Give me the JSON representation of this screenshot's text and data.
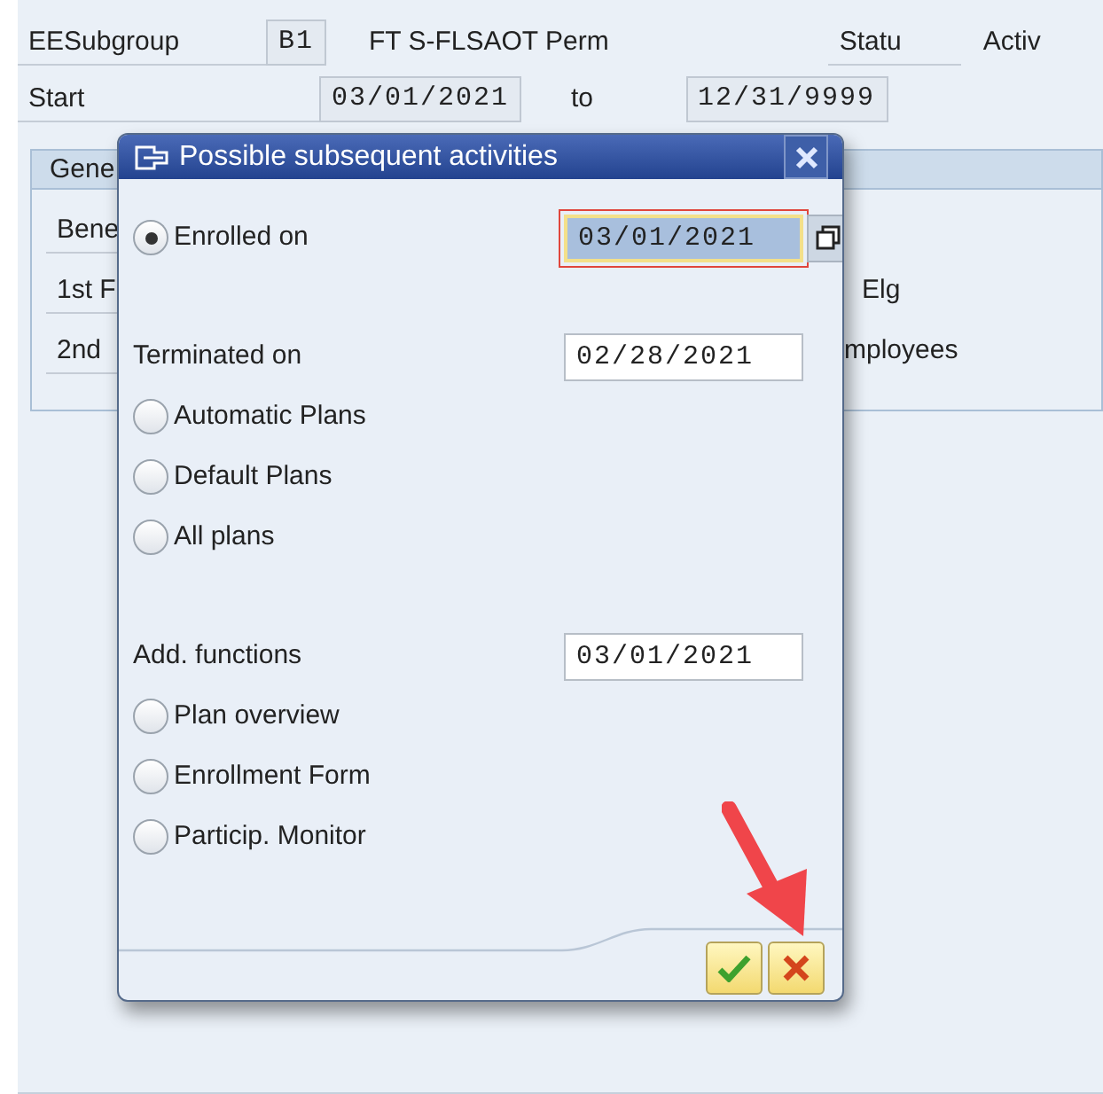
{
  "header": {
    "subgroup_label": "EESubgroup",
    "subgroup_code": "B1",
    "subgroup_text": "FT S-FLSAOT Perm",
    "status_label": "Statu",
    "status_value": "Activ",
    "start_label": "Start",
    "start_date": "03/01/2021",
    "to_label": "to",
    "end_date": "12/31/9999"
  },
  "group_box": {
    "tab": "Gene",
    "rows": [
      {
        "label": "Bene"
      },
      {
        "label": "1st F",
        "value": "Elg"
      },
      {
        "label": "2nd",
        "value": "mployees"
      }
    ]
  },
  "dialog": {
    "title": "Possible subsequent activities",
    "groups": [
      {
        "items": [
          {
            "kind": "radio",
            "label": "Enrolled on",
            "selected": true,
            "date": "03/01/2021",
            "focused": true
          }
        ]
      },
      {
        "items": [
          {
            "kind": "label",
            "label": "Terminated on",
            "date": "02/28/2021"
          },
          {
            "kind": "radio",
            "label": "Automatic Plans",
            "selected": false
          },
          {
            "kind": "radio",
            "label": "Default Plans",
            "selected": false
          },
          {
            "kind": "radio",
            "label": "All plans",
            "selected": false
          }
        ]
      },
      {
        "items": [
          {
            "kind": "label",
            "label": "Add. functions",
            "date": "03/01/2021"
          },
          {
            "kind": "radio",
            "label": "Plan overview",
            "selected": false
          },
          {
            "kind": "radio",
            "label": "Enrollment Form",
            "selected": false
          },
          {
            "kind": "radio",
            "label": "Particip. Monitor",
            "selected": false
          }
        ]
      }
    ]
  }
}
